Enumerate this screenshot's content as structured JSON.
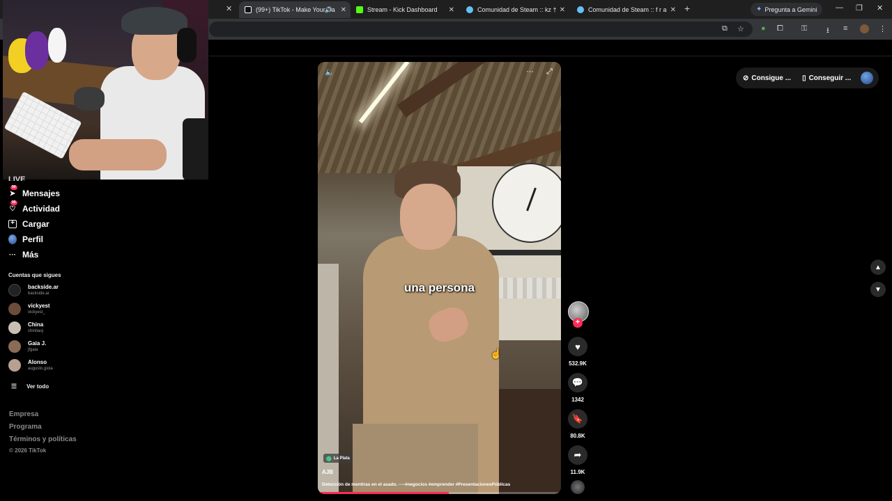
{
  "browser": {
    "tabs": [
      {
        "label": "(99+) TikTok - Make Your Da",
        "favicon_color": "#ffffff",
        "active": true
      },
      {
        "label": "Stream - Kick Dashboard",
        "favicon_color": "#53fc18",
        "active": false
      },
      {
        "label": "Comunidad de Steam :: kz †",
        "favicon_color": "#66c0f4",
        "active": false
      },
      {
        "label": "Comunidad de Steam :: f r a",
        "favicon_color": "#66c0f4",
        "active": false
      }
    ],
    "new_tab": "+",
    "gemini_label": "Pregunta a Gemini",
    "window_controls": {
      "minimize": "—",
      "restore": "❐",
      "close": "✕"
    }
  },
  "sidebar": {
    "partial_item": "LIVE",
    "nav": [
      {
        "label": "Mensajes",
        "icon": "send-icon",
        "badge": "99"
      },
      {
        "label": "Actividad",
        "icon": "inbox-icon",
        "badge": "99"
      },
      {
        "label": "Cargar",
        "icon": "upload-icon"
      },
      {
        "label": "Perfil",
        "icon": "profile-icon"
      },
      {
        "label": "Más",
        "icon": "more-icon"
      }
    ],
    "following_title": "Cuentas que sigues",
    "accounts": [
      {
        "name": "backside.ar",
        "handle": "backside.ar",
        "color": "#222222"
      },
      {
        "name": "vickyest",
        "handle": "vickyest_",
        "color": "#6b4b3a"
      },
      {
        "name": "China",
        "handle": "chinitaoj",
        "color": "#c9c0b4"
      },
      {
        "name": "Gaia J.",
        "handle": "jfgaia",
        "color": "#8a6b55"
      },
      {
        "name": "Alonso",
        "handle": "augusto.gioia",
        "color": "#b8a090"
      }
    ],
    "see_all": "Ver todo",
    "footer_links": [
      "Empresa",
      "Programa",
      "Términos y políticas"
    ],
    "copyright": "© 2026 TikTok"
  },
  "video": {
    "caption": "una persona",
    "location": "La Plata",
    "author": "AJB",
    "description": "Detección de mentiras en el asado.    ----#negocios #emprender #PresentacionesPúblicas",
    "progress": 0.54
  },
  "actions": {
    "likes": "532.9K",
    "comments": "1342",
    "saves": "80.8K",
    "shares": "11.9K"
  },
  "top_right": {
    "coins_label": "Consigue ...",
    "app_label": "Conseguir ..."
  }
}
